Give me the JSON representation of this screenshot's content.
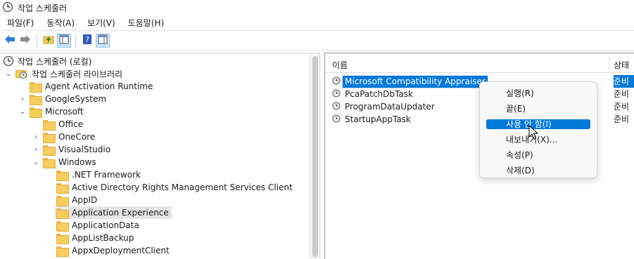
{
  "window": {
    "title": "작업 스케줄러"
  },
  "menubar": [
    "파일(F)",
    "동작(A)",
    "보기(V)",
    "도움말(H)"
  ],
  "toolbar": {
    "buttons": [
      "back-icon",
      "forward-icon",
      "up-folder-icon",
      "show-hide-tree-icon",
      "help-icon",
      "show-hide-action-pane-icon"
    ]
  },
  "tree": {
    "items": [
      {
        "label": "작업 스케줄러 (로컬)",
        "level": 0,
        "expander": "",
        "icon": "clock"
      },
      {
        "label": "작업 스케줄러 라이브러리",
        "level": 0,
        "expander": "expanded",
        "icon": "folder-clock"
      },
      {
        "label": "Agent Activation Runtime",
        "level": 1,
        "expander": "",
        "icon": "folder"
      },
      {
        "label": "GoogleSystem",
        "level": 1,
        "expander": "collapsed",
        "icon": "folder"
      },
      {
        "label": "Microsoft",
        "level": 1,
        "expander": "expanded",
        "icon": "folder"
      },
      {
        "label": "Office",
        "level": 2,
        "expander": "",
        "icon": "folder"
      },
      {
        "label": "OneCore",
        "level": 2,
        "expander": "collapsed",
        "icon": "folder"
      },
      {
        "label": "VisualStudio",
        "level": 2,
        "expander": "collapsed",
        "icon": "folder"
      },
      {
        "label": "Windows",
        "level": 2,
        "expander": "expanded",
        "icon": "folder"
      },
      {
        "label": ".NET Framework",
        "level": 3,
        "expander": "",
        "icon": "folder"
      },
      {
        "label": "Active Directory Rights Management Services Client",
        "level": 3,
        "expander": "",
        "icon": "folder"
      },
      {
        "label": "AppID",
        "level": 3,
        "expander": "",
        "icon": "folder"
      },
      {
        "label": "Application Experience",
        "level": 3,
        "expander": "",
        "icon": "folder",
        "selected": true
      },
      {
        "label": "ApplicationData",
        "level": 3,
        "expander": "",
        "icon": "folder"
      },
      {
        "label": "AppListBackup",
        "level": 3,
        "expander": "",
        "icon": "folder"
      },
      {
        "label": "AppxDeploymentClient",
        "level": 3,
        "expander": "",
        "icon": "folder"
      }
    ]
  },
  "tasklist": {
    "headers": {
      "name": "이름",
      "status": "상태"
    },
    "rows": [
      {
        "name": "Microsoft Compatibility Appraiser",
        "status": "준비",
        "selected": true
      },
      {
        "name": "PcaPatchDbTask",
        "status": "준비"
      },
      {
        "name": "ProgramDataUpdater",
        "status": "준비"
      },
      {
        "name": "StartupAppTask",
        "status": "준비"
      }
    ]
  },
  "context_menu": {
    "items": [
      {
        "label": "실행(R)"
      },
      {
        "label": "끝(E)"
      },
      {
        "label": "사용 안 함(I)",
        "highlighted": true
      },
      {
        "label": "내보내기(X)..."
      },
      {
        "label": "속성(P)"
      },
      {
        "label": "삭제(D)"
      }
    ]
  },
  "colors": {
    "selection": "#0078d7",
    "tree_selection": "#e5e5e5",
    "folder": "#f6cd5e"
  }
}
